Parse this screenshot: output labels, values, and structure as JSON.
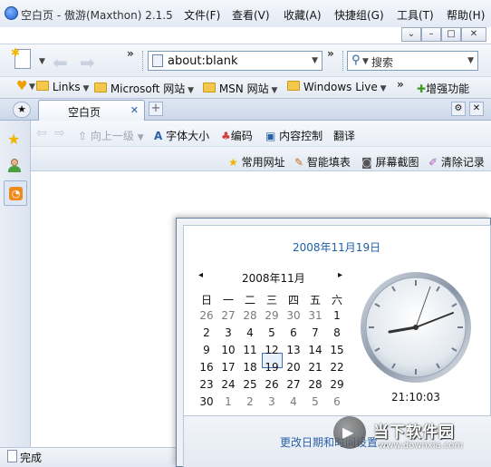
{
  "window": {
    "title": "空白页 - 傲游(Maxthon) 2.1.5",
    "menu": [
      "文件(F)",
      "查看(V)",
      "收藏(A)",
      "快捷组(G)",
      "工具(T)",
      "帮助(H)"
    ],
    "controls": [
      "⌄",
      "–",
      "□",
      "✕"
    ]
  },
  "toolbar": {
    "overflow1": "»",
    "address": "about:blank",
    "overflow2": "»",
    "search_placeholder": "搜索"
  },
  "bookmarks": {
    "items": [
      "Links",
      "Microsoft 网站",
      "MSN 网站",
      "Windows Live"
    ],
    "overflow": "»",
    "addon": "增强功能"
  },
  "tabs": {
    "active_label": "空白页",
    "close": "✕",
    "new_tab": "+"
  },
  "navbar": {
    "up": "向上一级",
    "font_size": "字体大小",
    "encoding": "编码",
    "content_control": "内容控制",
    "translate": "翻译"
  },
  "favbar": {
    "common_sites": "常用网址",
    "smart_fill": "智能填表",
    "screenshot": "屏幕截图",
    "clear_records": "清除记录"
  },
  "status": {
    "text": "完成"
  },
  "calendar": {
    "date_header": "2008年11月19日",
    "month_label": "2008年11月",
    "prev": "◂",
    "next": "▸",
    "weekdays": [
      "日",
      "一",
      "二",
      "三",
      "四",
      "五",
      "六"
    ],
    "weeks": [
      [
        "26",
        "27",
        "28",
        "29",
        "30",
        "31",
        "1"
      ],
      [
        "2",
        "3",
        "4",
        "5",
        "6",
        "7",
        "8"
      ],
      [
        "9",
        "10",
        "11",
        "12",
        "13",
        "14",
        "15"
      ],
      [
        "16",
        "17",
        "18",
        "19",
        "20",
        "21",
        "22"
      ],
      [
        "23",
        "24",
        "25",
        "26",
        "27",
        "28",
        "29"
      ],
      [
        "30",
        "1",
        "2",
        "3",
        "4",
        "5",
        "6"
      ]
    ],
    "today": "19",
    "time": "21:10:03",
    "change_link": "更改日期和时间设置...",
    "watermark_cn": "当下软件园",
    "watermark_en": "www.downxia.com"
  },
  "colors": {
    "accent": "#1f5fa8",
    "link": "#2a5fa5",
    "star": "#f0b400",
    "rss": "#f08a1c"
  }
}
